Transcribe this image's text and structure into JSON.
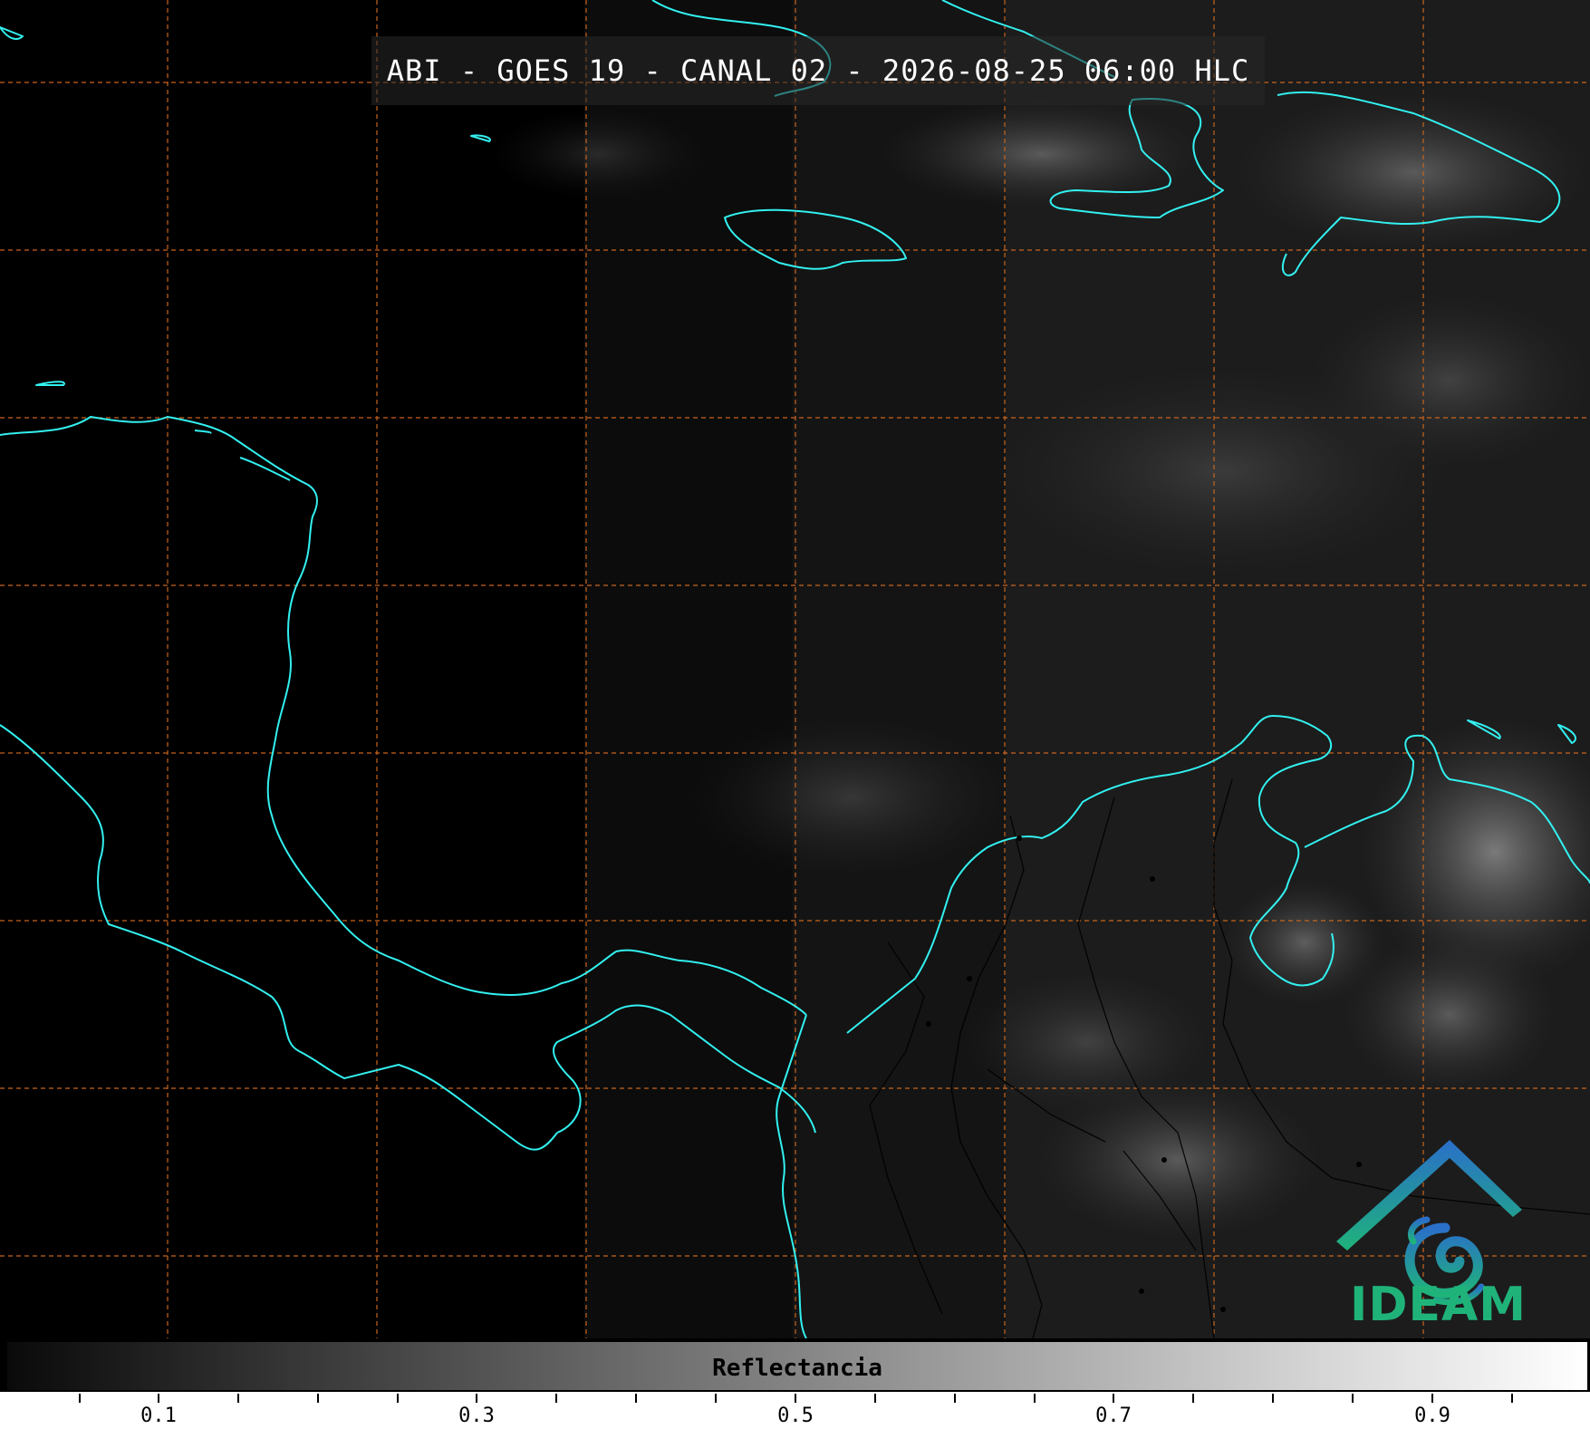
{
  "map": {
    "title": "ABI - GOES 19 - CANAL 02 - 2026-08-25 06:00 HLC",
    "coastline_color": "#33f0f0",
    "graticule_color": "#c8641e",
    "border_color": "#000000"
  },
  "colorbar": {
    "label": "Reflectancia",
    "tick_labels": [
      "0.1",
      "0.3",
      "0.5",
      "0.7",
      "0.9"
    ],
    "gradient": [
      "#0a0a0a",
      "#ffffff"
    ]
  },
  "logo": {
    "text": "IDEAM",
    "icon": "ideam-logo-icon",
    "colors": [
      "#2a6fc9",
      "#1fb37a"
    ]
  }
}
